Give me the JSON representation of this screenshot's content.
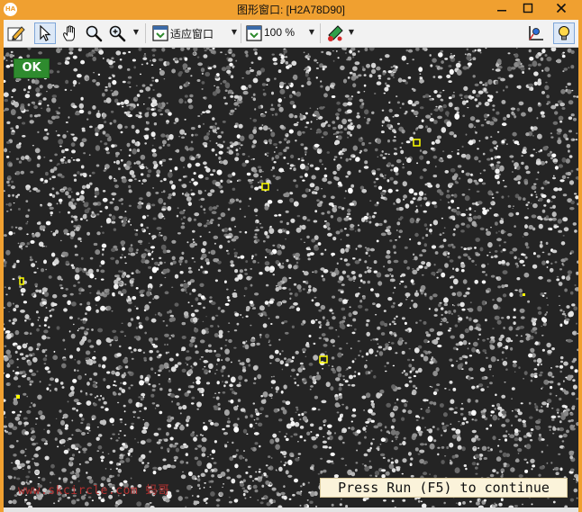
{
  "window": {
    "title": "图形窗口: [H2A78D90]",
    "app_icon": "HA"
  },
  "toolbar": {
    "zoom_mode": "适应窗口",
    "zoom_level": "100 %"
  },
  "canvas": {
    "ok_label": "OK",
    "watermark": "www.skcircle.com 蚂哥",
    "status_message": "Press Run (F5) to continue"
  },
  "colors": {
    "window_frame": "#F0A030",
    "ok_badge": "#2e8b2e",
    "marker": "#FFFF00",
    "status_bg": "#FBF3DA"
  }
}
